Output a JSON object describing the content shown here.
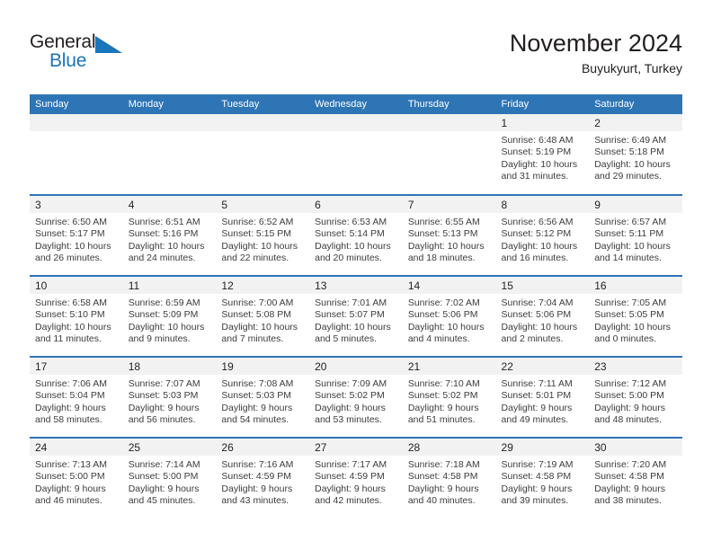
{
  "brand": {
    "name_part1": "General",
    "name_part2": "Blue",
    "accent_color": "#1b75bb"
  },
  "header": {
    "title": "November 2024",
    "location": "Buyukyurt, Turkey",
    "header_bg": "#2e75b6",
    "daynum_bg": "#f2f2f2"
  },
  "weekday_headers": [
    "Sunday",
    "Monday",
    "Tuesday",
    "Wednesday",
    "Thursday",
    "Friday",
    "Saturday"
  ],
  "weeks": [
    [
      {
        "day": "",
        "sunrise": "",
        "sunset": "",
        "daylight1": "",
        "daylight2": ""
      },
      {
        "day": "",
        "sunrise": "",
        "sunset": "",
        "daylight1": "",
        "daylight2": ""
      },
      {
        "day": "",
        "sunrise": "",
        "sunset": "",
        "daylight1": "",
        "daylight2": ""
      },
      {
        "day": "",
        "sunrise": "",
        "sunset": "",
        "daylight1": "",
        "daylight2": ""
      },
      {
        "day": "",
        "sunrise": "",
        "sunset": "",
        "daylight1": "",
        "daylight2": ""
      },
      {
        "day": "1",
        "sunrise": "Sunrise: 6:48 AM",
        "sunset": "Sunset: 5:19 PM",
        "daylight1": "Daylight: 10 hours",
        "daylight2": "and 31 minutes."
      },
      {
        "day": "2",
        "sunrise": "Sunrise: 6:49 AM",
        "sunset": "Sunset: 5:18 PM",
        "daylight1": "Daylight: 10 hours",
        "daylight2": "and 29 minutes."
      }
    ],
    [
      {
        "day": "3",
        "sunrise": "Sunrise: 6:50 AM",
        "sunset": "Sunset: 5:17 PM",
        "daylight1": "Daylight: 10 hours",
        "daylight2": "and 26 minutes."
      },
      {
        "day": "4",
        "sunrise": "Sunrise: 6:51 AM",
        "sunset": "Sunset: 5:16 PM",
        "daylight1": "Daylight: 10 hours",
        "daylight2": "and 24 minutes."
      },
      {
        "day": "5",
        "sunrise": "Sunrise: 6:52 AM",
        "sunset": "Sunset: 5:15 PM",
        "daylight1": "Daylight: 10 hours",
        "daylight2": "and 22 minutes."
      },
      {
        "day": "6",
        "sunrise": "Sunrise: 6:53 AM",
        "sunset": "Sunset: 5:14 PM",
        "daylight1": "Daylight: 10 hours",
        "daylight2": "and 20 minutes."
      },
      {
        "day": "7",
        "sunrise": "Sunrise: 6:55 AM",
        "sunset": "Sunset: 5:13 PM",
        "daylight1": "Daylight: 10 hours",
        "daylight2": "and 18 minutes."
      },
      {
        "day": "8",
        "sunrise": "Sunrise: 6:56 AM",
        "sunset": "Sunset: 5:12 PM",
        "daylight1": "Daylight: 10 hours",
        "daylight2": "and 16 minutes."
      },
      {
        "day": "9",
        "sunrise": "Sunrise: 6:57 AM",
        "sunset": "Sunset: 5:11 PM",
        "daylight1": "Daylight: 10 hours",
        "daylight2": "and 14 minutes."
      }
    ],
    [
      {
        "day": "10",
        "sunrise": "Sunrise: 6:58 AM",
        "sunset": "Sunset: 5:10 PM",
        "daylight1": "Daylight: 10 hours",
        "daylight2": "and 11 minutes."
      },
      {
        "day": "11",
        "sunrise": "Sunrise: 6:59 AM",
        "sunset": "Sunset: 5:09 PM",
        "daylight1": "Daylight: 10 hours",
        "daylight2": "and 9 minutes."
      },
      {
        "day": "12",
        "sunrise": "Sunrise: 7:00 AM",
        "sunset": "Sunset: 5:08 PM",
        "daylight1": "Daylight: 10 hours",
        "daylight2": "and 7 minutes."
      },
      {
        "day": "13",
        "sunrise": "Sunrise: 7:01 AM",
        "sunset": "Sunset: 5:07 PM",
        "daylight1": "Daylight: 10 hours",
        "daylight2": "and 5 minutes."
      },
      {
        "day": "14",
        "sunrise": "Sunrise: 7:02 AM",
        "sunset": "Sunset: 5:06 PM",
        "daylight1": "Daylight: 10 hours",
        "daylight2": "and 4 minutes."
      },
      {
        "day": "15",
        "sunrise": "Sunrise: 7:04 AM",
        "sunset": "Sunset: 5:06 PM",
        "daylight1": "Daylight: 10 hours",
        "daylight2": "and 2 minutes."
      },
      {
        "day": "16",
        "sunrise": "Sunrise: 7:05 AM",
        "sunset": "Sunset: 5:05 PM",
        "daylight1": "Daylight: 10 hours",
        "daylight2": "and 0 minutes."
      }
    ],
    [
      {
        "day": "17",
        "sunrise": "Sunrise: 7:06 AM",
        "sunset": "Sunset: 5:04 PM",
        "daylight1": "Daylight: 9 hours",
        "daylight2": "and 58 minutes."
      },
      {
        "day": "18",
        "sunrise": "Sunrise: 7:07 AM",
        "sunset": "Sunset: 5:03 PM",
        "daylight1": "Daylight: 9 hours",
        "daylight2": "and 56 minutes."
      },
      {
        "day": "19",
        "sunrise": "Sunrise: 7:08 AM",
        "sunset": "Sunset: 5:03 PM",
        "daylight1": "Daylight: 9 hours",
        "daylight2": "and 54 minutes."
      },
      {
        "day": "20",
        "sunrise": "Sunrise: 7:09 AM",
        "sunset": "Sunset: 5:02 PM",
        "daylight1": "Daylight: 9 hours",
        "daylight2": "and 53 minutes."
      },
      {
        "day": "21",
        "sunrise": "Sunrise: 7:10 AM",
        "sunset": "Sunset: 5:02 PM",
        "daylight1": "Daylight: 9 hours",
        "daylight2": "and 51 minutes."
      },
      {
        "day": "22",
        "sunrise": "Sunrise: 7:11 AM",
        "sunset": "Sunset: 5:01 PM",
        "daylight1": "Daylight: 9 hours",
        "daylight2": "and 49 minutes."
      },
      {
        "day": "23",
        "sunrise": "Sunrise: 7:12 AM",
        "sunset": "Sunset: 5:00 PM",
        "daylight1": "Daylight: 9 hours",
        "daylight2": "and 48 minutes."
      }
    ],
    [
      {
        "day": "24",
        "sunrise": "Sunrise: 7:13 AM",
        "sunset": "Sunset: 5:00 PM",
        "daylight1": "Daylight: 9 hours",
        "daylight2": "and 46 minutes."
      },
      {
        "day": "25",
        "sunrise": "Sunrise: 7:14 AM",
        "sunset": "Sunset: 5:00 PM",
        "daylight1": "Daylight: 9 hours",
        "daylight2": "and 45 minutes."
      },
      {
        "day": "26",
        "sunrise": "Sunrise: 7:16 AM",
        "sunset": "Sunset: 4:59 PM",
        "daylight1": "Daylight: 9 hours",
        "daylight2": "and 43 minutes."
      },
      {
        "day": "27",
        "sunrise": "Sunrise: 7:17 AM",
        "sunset": "Sunset: 4:59 PM",
        "daylight1": "Daylight: 9 hours",
        "daylight2": "and 42 minutes."
      },
      {
        "day": "28",
        "sunrise": "Sunrise: 7:18 AM",
        "sunset": "Sunset: 4:58 PM",
        "daylight1": "Daylight: 9 hours",
        "daylight2": "and 40 minutes."
      },
      {
        "day": "29",
        "sunrise": "Sunrise: 7:19 AM",
        "sunset": "Sunset: 4:58 PM",
        "daylight1": "Daylight: 9 hours",
        "daylight2": "and 39 minutes."
      },
      {
        "day": "30",
        "sunrise": "Sunrise: 7:20 AM",
        "sunset": "Sunset: 4:58 PM",
        "daylight1": "Daylight: 9 hours",
        "daylight2": "and 38 minutes."
      }
    ]
  ]
}
